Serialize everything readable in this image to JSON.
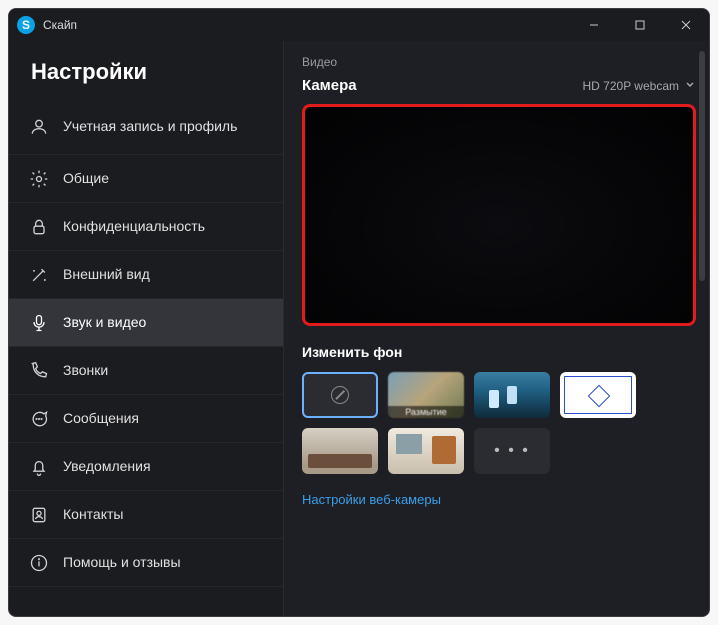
{
  "window": {
    "title": "Скайп"
  },
  "sidebar": {
    "heading": "Настройки",
    "items": [
      {
        "label": "Учетная запись и профиль",
        "icon": "user"
      },
      {
        "label": "Общие",
        "icon": "gear"
      },
      {
        "label": "Конфиденциальность",
        "icon": "lock"
      },
      {
        "label": "Внешний вид",
        "icon": "wand"
      },
      {
        "label": "Звук и видео",
        "icon": "mic",
        "selected": true
      },
      {
        "label": "Звонки",
        "icon": "phone"
      },
      {
        "label": "Сообщения",
        "icon": "chat"
      },
      {
        "label": "Уведомления",
        "icon": "bell"
      },
      {
        "label": "Контакты",
        "icon": "contacts"
      },
      {
        "label": "Помощь и отзывы",
        "icon": "info"
      }
    ]
  },
  "content": {
    "section_label": "Видео",
    "camera_label": "Камера",
    "camera_selected": "HD 720P webcam",
    "bg_heading": "Изменить фон",
    "bg_tiles": {
      "none": "",
      "blur_label": "Размытие",
      "more": "• • •"
    },
    "webcam_settings_link": "Настройки веб-камеры"
  }
}
